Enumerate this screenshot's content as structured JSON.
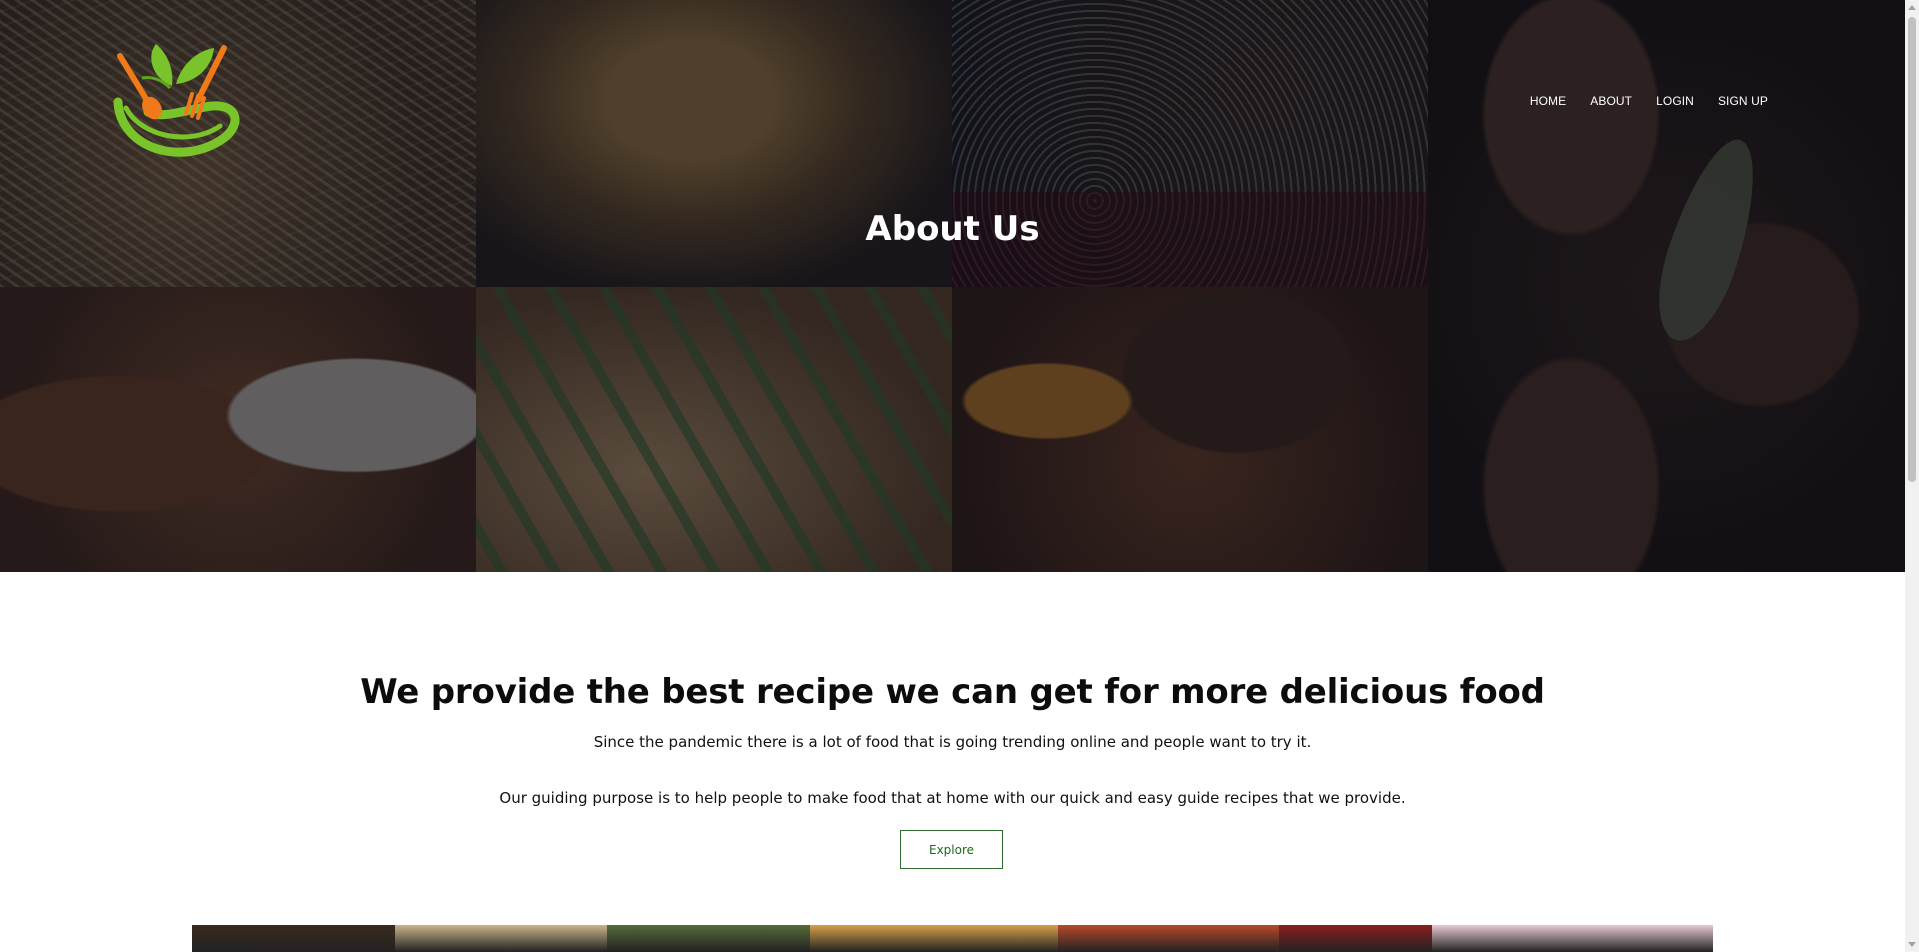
{
  "logo": {
    "icon": "bowl-leaf-utensils-logo",
    "colors": {
      "green": "#7ac42b",
      "orange": "#f07a1a"
    }
  },
  "nav": {
    "items": [
      {
        "label": "HOME"
      },
      {
        "label": "ABOUT"
      },
      {
        "label": "LOGIN"
      },
      {
        "label": "SIGN UP"
      }
    ]
  },
  "hero": {
    "title": "About Us"
  },
  "about": {
    "heading": "We provide the best recipe we can get for more delicious food",
    "paragraph1": "Since the pandemic there is a lot of food that is going trending online and people want to try it.",
    "paragraph2": "Our guiding purpose is to help people to make food that at home with our quick and easy guide recipes that we provide.",
    "explore_label": "Explore",
    "accent": "#2e6b2e"
  },
  "strip_colors": [
    "#3a2a1e",
    "#c9b58a",
    "#556b3a",
    "#d6a04a",
    "#b8492a",
    "#8a1f1f",
    "#e7c9d3"
  ]
}
